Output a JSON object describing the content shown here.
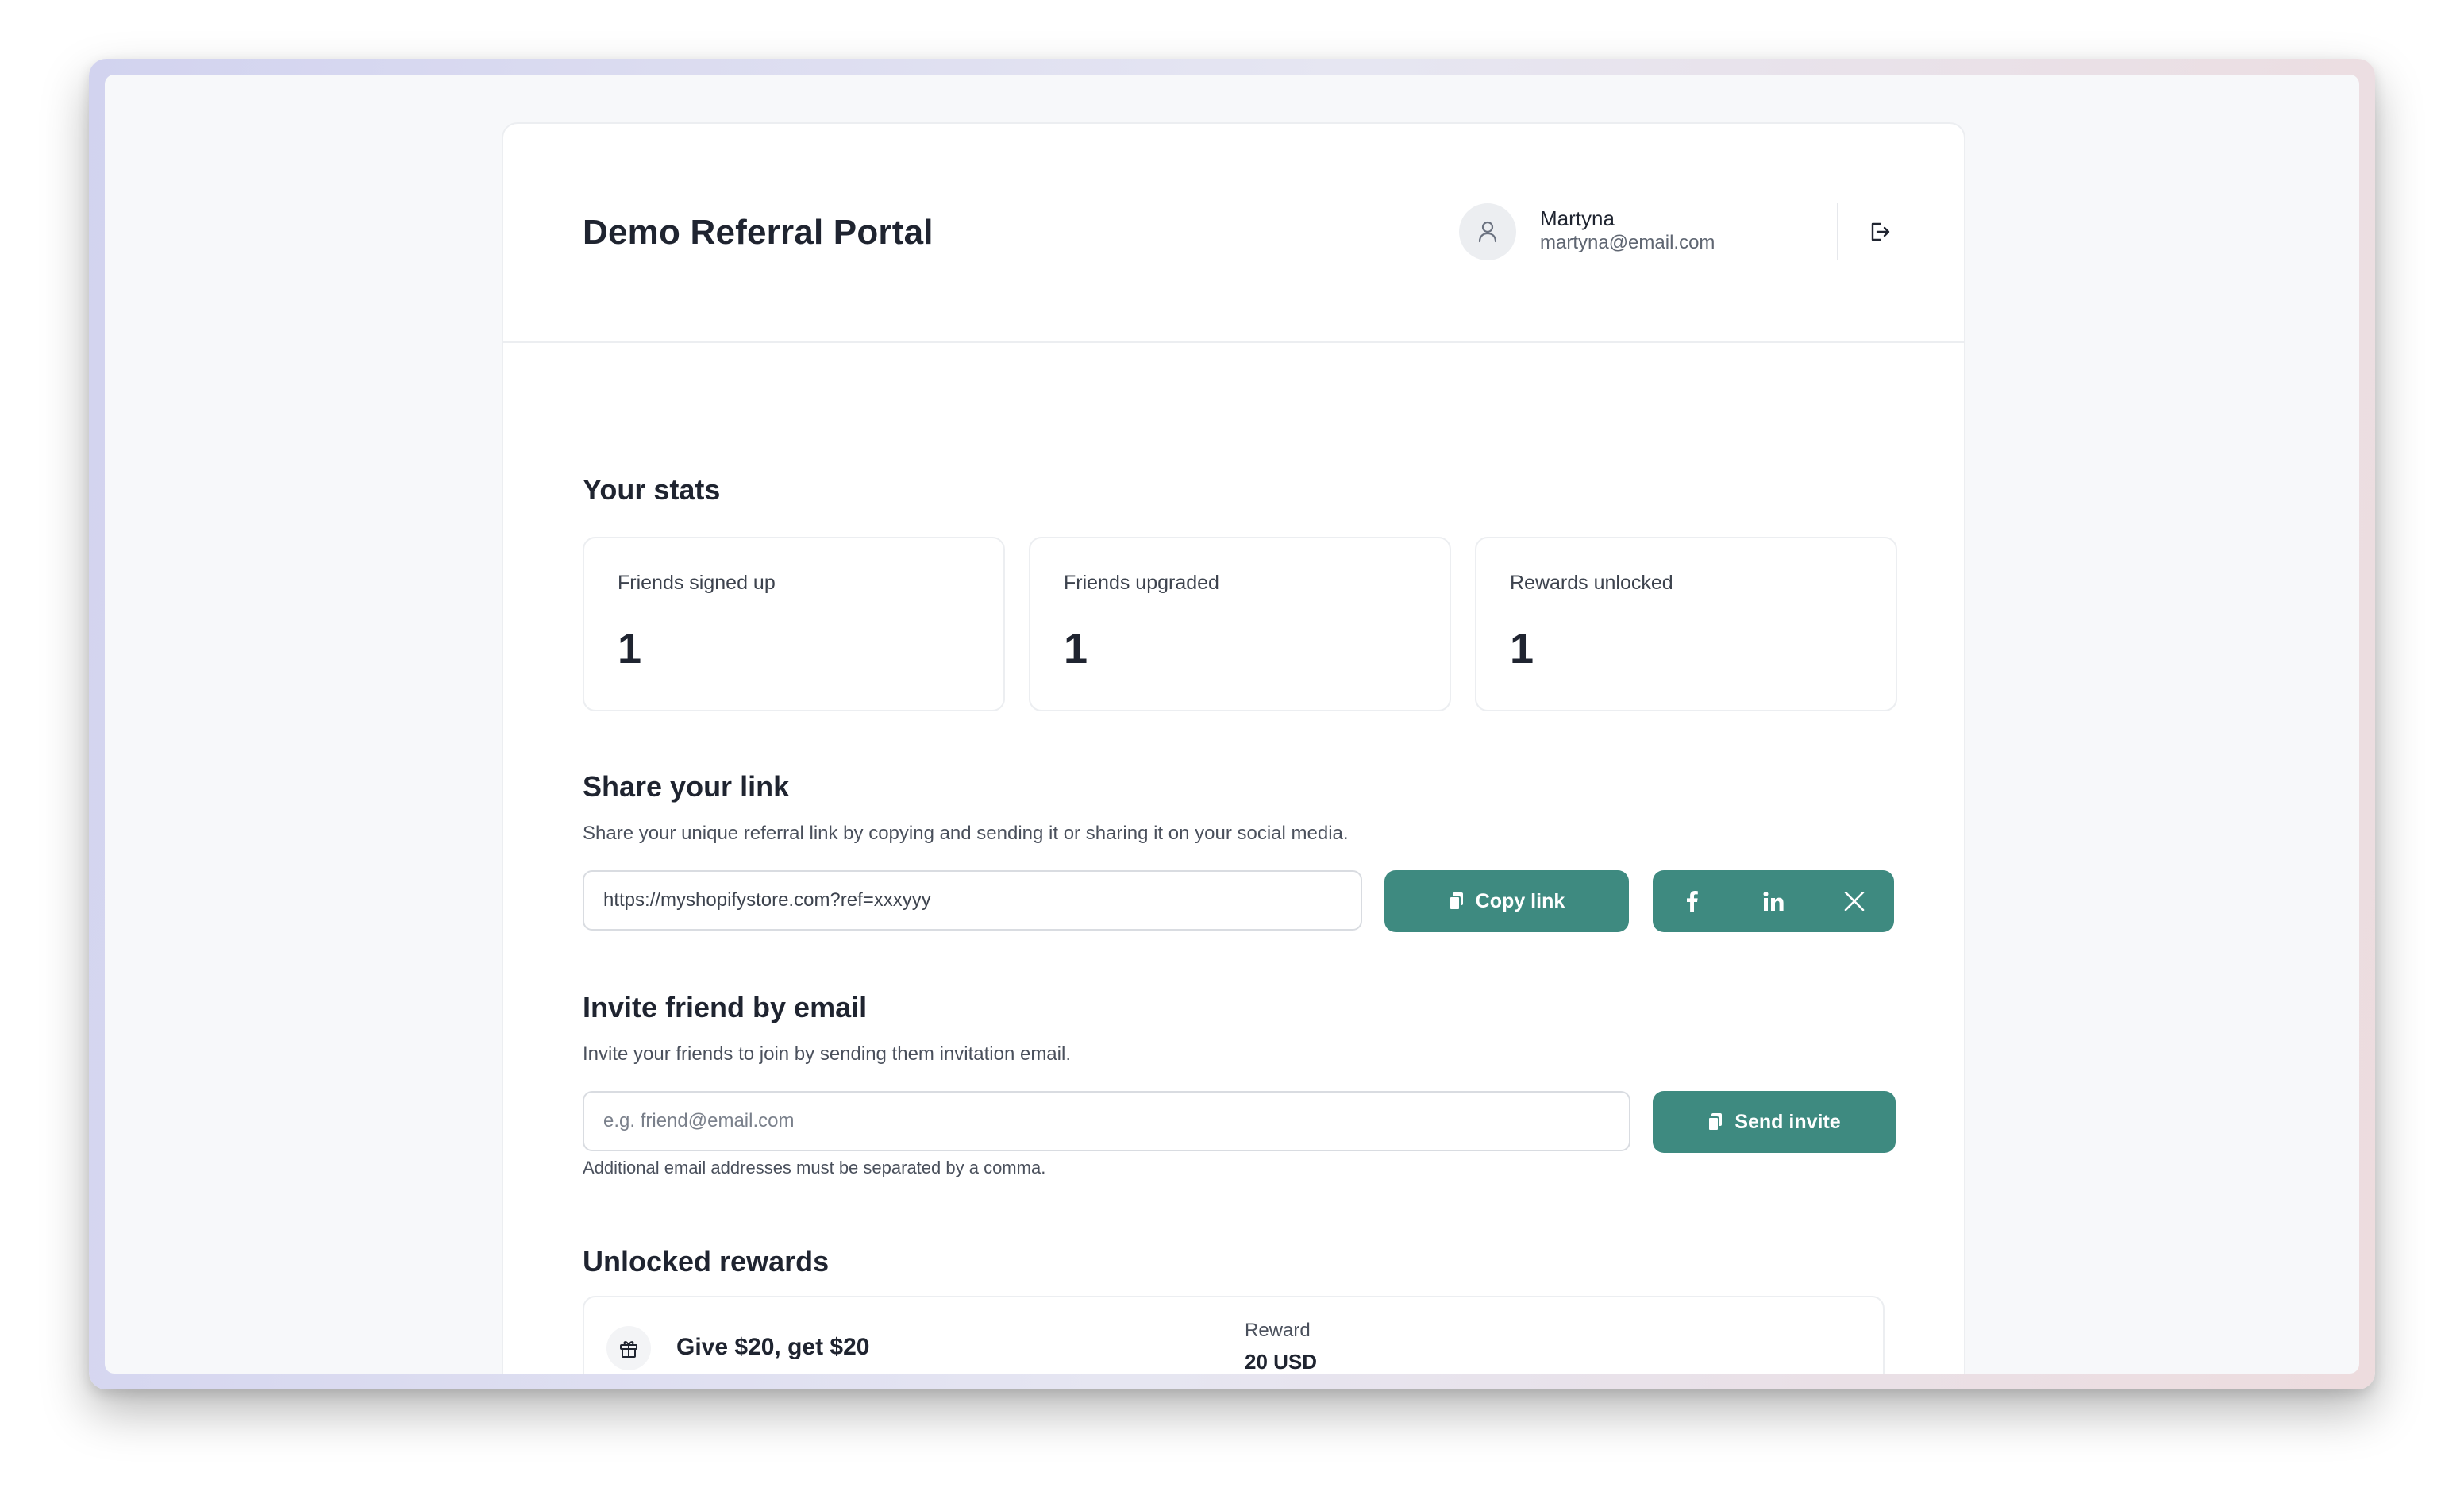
{
  "app": {
    "title": "Demo Referral Portal"
  },
  "user": {
    "name": "Martyna",
    "email": "martyna@email.com"
  },
  "stats": {
    "title": "Your stats",
    "items": [
      {
        "label": "Friends signed up",
        "value": "1"
      },
      {
        "label": "Friends upgraded",
        "value": "1"
      },
      {
        "label": "Rewards unlocked",
        "value": "1"
      }
    ]
  },
  "share": {
    "title": "Share your link",
    "description": "Share your unique referral link by copying and sending it or sharing it on your social media.",
    "link_value": "https://myshopifystore.com?ref=xxxyyy",
    "copy_label": "Copy link",
    "social": [
      "facebook-icon",
      "linkedin-icon",
      "x-icon"
    ]
  },
  "invite": {
    "title": "Invite friend by email",
    "description": "Invite your friends to join by sending them invitation email.",
    "placeholder": "e.g. friend@email.com",
    "send_label": "Send invite",
    "hint": "Additional email addresses must be separated by a comma."
  },
  "rewards": {
    "title": "Unlocked rewards",
    "items": [
      {
        "name": "Give $20, get $20",
        "label": "Reward",
        "value": "20 USD"
      }
    ]
  },
  "colors": {
    "accent": "#3e8a80",
    "background": "#f7f8fa",
    "border": "#eceef1"
  }
}
